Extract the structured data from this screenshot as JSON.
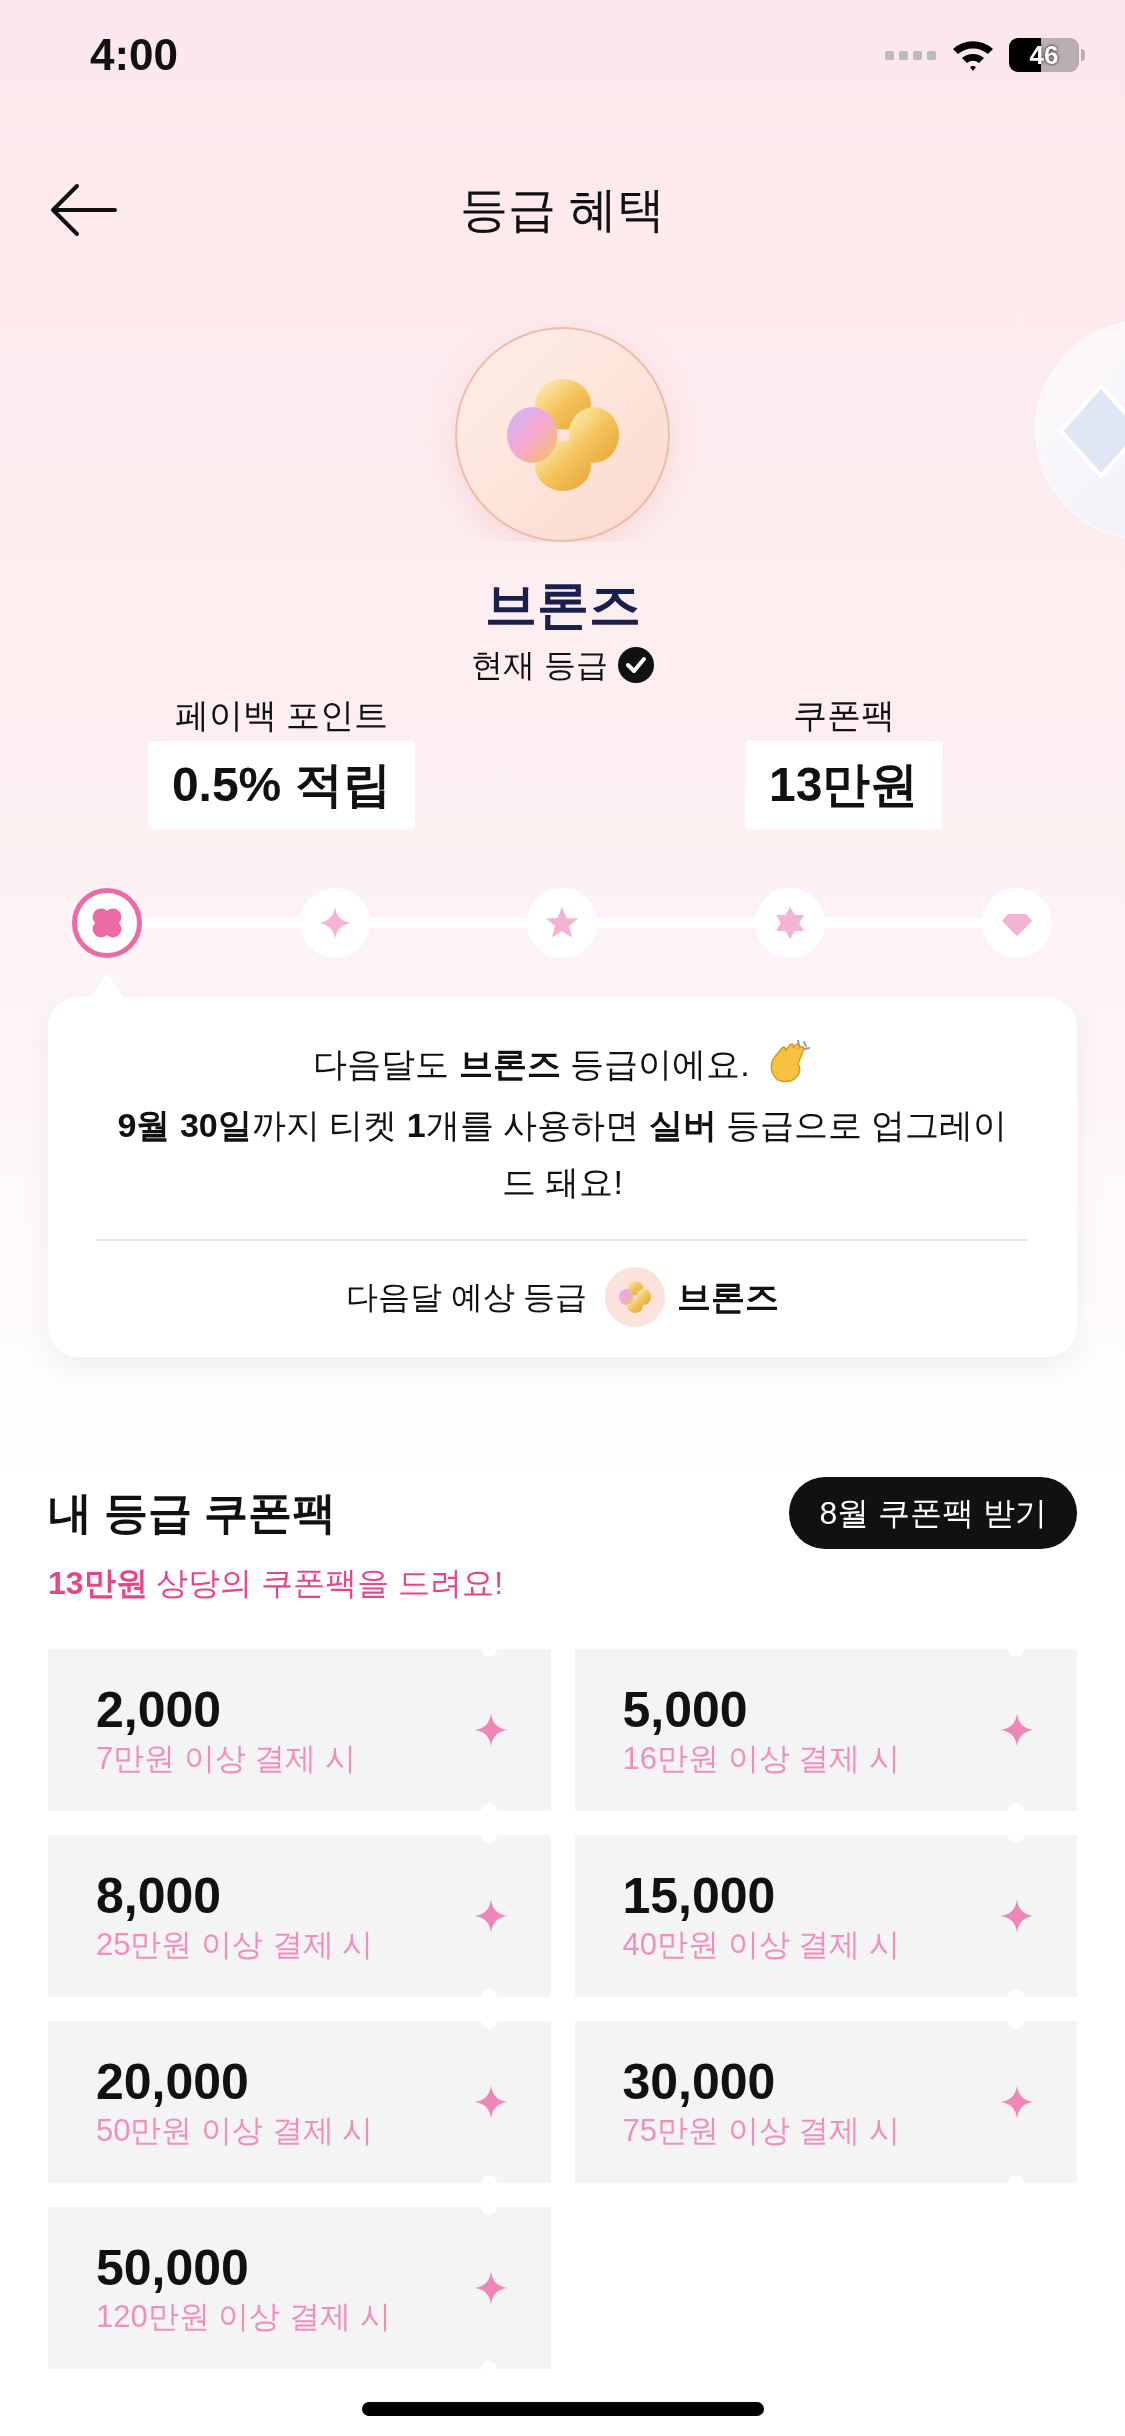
{
  "status_bar": {
    "time": "4:00",
    "battery": "46"
  },
  "header": {
    "title": "등급 혜택"
  },
  "grade": {
    "name": "브론즈",
    "current_label": "현재 등급"
  },
  "benefits": [
    {
      "label": "페이백 포인트",
      "value": "0.5% 적립"
    },
    {
      "label": "쿠폰팩",
      "value": "13만원"
    }
  ],
  "steps": [
    {
      "kind": "clover",
      "selected": true
    },
    {
      "kind": "sparkle",
      "selected": false
    },
    {
      "kind": "star",
      "selected": false
    },
    {
      "kind": "hexstar",
      "selected": false
    },
    {
      "kind": "diamond",
      "selected": false
    }
  ],
  "notice": {
    "line_1": "다음달도 **브론즈** 등급이에요.",
    "line_2": "**9월 30일**까지 티켓 **1**개를 사용하면 **실버** 등급으로 업그레이드 돼요!",
    "forecast_label": "다음달 예상 등급",
    "forecast_grade": "브론즈"
  },
  "coupon_pack": {
    "title": "내 등급 쿠폰팩",
    "button": "8월 쿠폰팩 받기",
    "subtitle": "**13만원** 상당의 쿠폰팩을 드려요!",
    "coupons": [
      {
        "amount": "2,000",
        "condition": "7만원 이상 결제 시"
      },
      {
        "amount": "5,000",
        "condition": "16만원 이상 결제 시"
      },
      {
        "amount": "8,000",
        "condition": "25만원 이상 결제 시"
      },
      {
        "amount": "15,000",
        "condition": "40만원 이상 결제 시"
      },
      {
        "amount": "20,000",
        "condition": "50만원 이상 결제 시"
      },
      {
        "amount": "30,000",
        "condition": "75만원 이상 결제 시"
      },
      {
        "amount": "50,000",
        "condition": "120만원 이상 결제 시"
      }
    ]
  }
}
